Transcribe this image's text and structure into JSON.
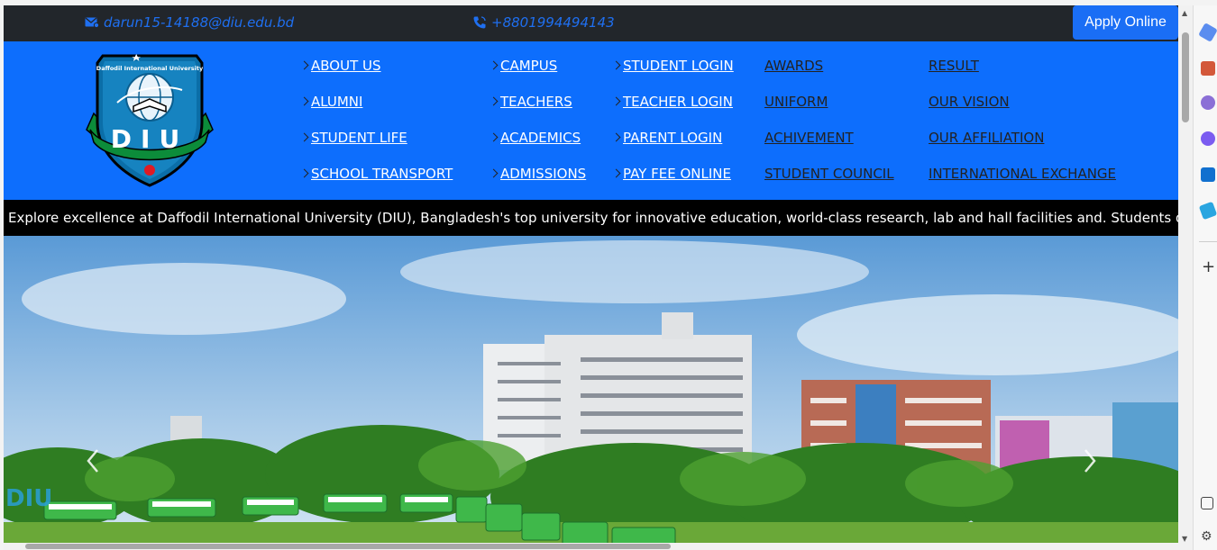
{
  "topbar": {
    "email": "darun15-14188@diu.edu.bd",
    "phone": "+8801994494143",
    "apply_label": "Apply Online"
  },
  "logo": {
    "university_name": "Daffodil International University",
    "letters": "DIU"
  },
  "nav": {
    "col1": [
      "ABOUT US",
      "ALUMNI",
      "STUDENT LIFE",
      "SCHOOL TRANSPORT"
    ],
    "col2": [
      "CAMPUS",
      "TEACHERS",
      "ACADEMICS",
      "ADMISSIONS"
    ],
    "col3": [
      "STUDENT LOGIN",
      "TEACHER LOGIN",
      "PARENT LOGIN",
      "PAY FEE ONLINE"
    ],
    "col4": [
      "AWARDS",
      "UNIFORM",
      "ACHIVEMENT",
      "STUDENT COUNCIL"
    ],
    "col5": [
      "RESULT",
      "OUR VISION",
      "OUR AFFILIATION",
      "INTERNATIONAL EXCHANGE"
    ]
  },
  "ticker": {
    "text": "Explore excellence at Daffodil International University (DIU), Bangladesh's top university for innovative education, world-class research, lab and hall facilities and. Students do laboratory d"
  },
  "hero": {
    "watermark": "DIU"
  },
  "colors": {
    "topbar_bg": "#22262b",
    "accent_blue": "#0d6efd",
    "link_blue": "#1f6ff0",
    "ticker_bg": "#000000"
  }
}
